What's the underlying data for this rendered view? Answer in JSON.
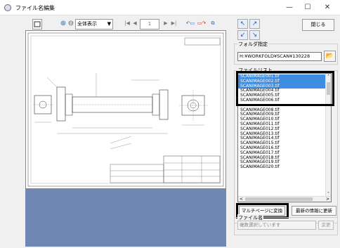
{
  "window": {
    "title": "ファイル名編集",
    "minimize_glyph": "—",
    "maximize_glyph": "☐",
    "close_glyph": "✕"
  },
  "toolbar": {
    "zoom_value": "全体表示",
    "page_number": "1"
  },
  "buttons": {
    "close_label": "閉じる",
    "multipage_label": "マルチページに変換",
    "refresh_label": "最新の情報に更新",
    "change_label": "変更"
  },
  "folder": {
    "label": "フォルダ指定",
    "path": "H:¥WORKFOLD¥SCAN¥130228"
  },
  "file_list": {
    "label": "ファイルリスト",
    "items": [
      "SCANIMAGE001.tif",
      "SCANIMAGE002.tif",
      "SCANIMAGE003.tif",
      "SCANIMAGE004.tif",
      "SCANIMAGE005.tif",
      "SCANIMAGE006.tif",
      "",
      "SCANIMAGE008.tif",
      "SCANIMAGE009.tif",
      "SCANIMAGE010.tif",
      "SCANIMAGE011.tif",
      "SCANIMAGE012.tif",
      "SCANIMAGE013.tif",
      "SCANIMAGE014.tif",
      "SCANIMAGE015.tif",
      "SCANIMAGE016.tif",
      "SCANIMAGE017.tif",
      "SCANIMAGE018.tif",
      "SCANIMAGE019.tif",
      "SCANIMAGE020.tif"
    ],
    "selected_count": 3
  },
  "filename": {
    "label": "ファイル名",
    "value": "複数選択しています"
  },
  "colors": {
    "selection": "#3f8de0",
    "viewer_bottom": "#6f87b3",
    "highlight_border": "#000000"
  }
}
